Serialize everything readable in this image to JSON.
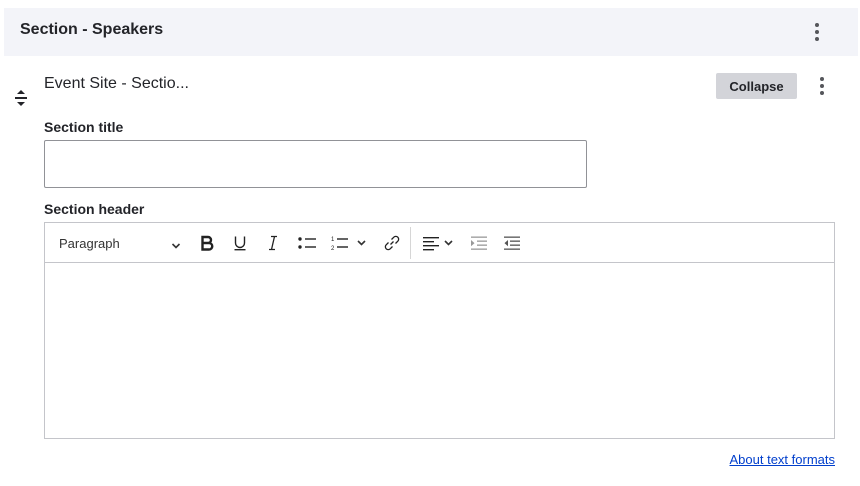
{
  "section": {
    "title": "Section - Speakers"
  },
  "paragraph": {
    "title": "Event Site - Sectio...",
    "collapse_label": "Collapse"
  },
  "fields": {
    "section_title_label": "Section title",
    "section_title_value": "",
    "section_header_label": "Section header"
  },
  "editor": {
    "block_format": "Paragraph",
    "toolbar_icons": [
      "bold-icon",
      "underline-icon",
      "italic-icon",
      "bulleted-list-icon",
      "numbered-list-icon",
      "link-icon",
      "align-left-icon",
      "indent-icon",
      "outdent-icon"
    ]
  },
  "footer": {
    "about_text_formats": "About text formats"
  }
}
